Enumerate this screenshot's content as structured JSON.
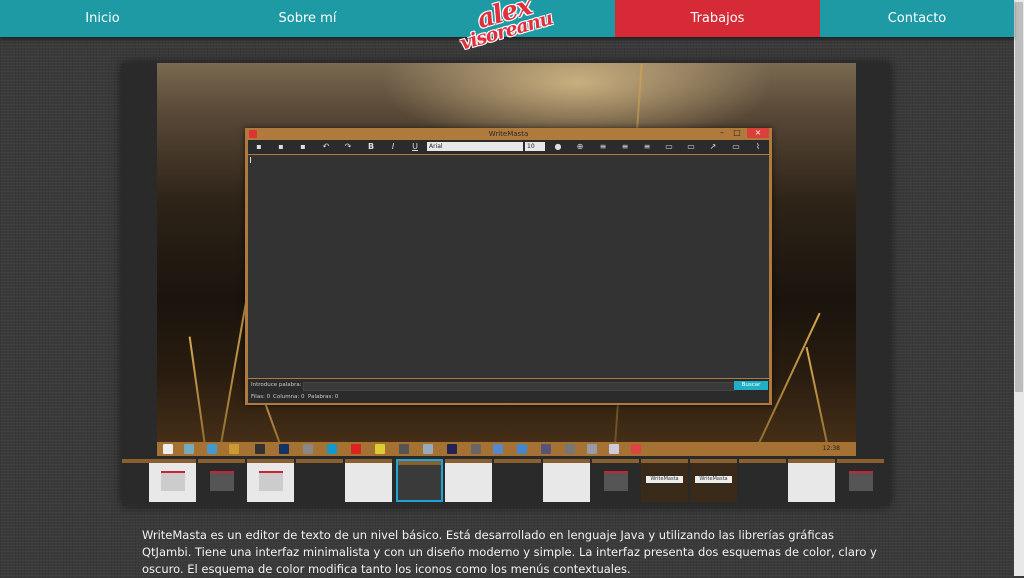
{
  "nav": {
    "items": [
      "Inicio",
      "Sobre mí",
      "Trabajos",
      "Contacto"
    ],
    "active": "Trabajos",
    "logo_line1": "alex",
    "logo_line2": "visoreanu"
  },
  "colors": {
    "nav": "#1e9aa4",
    "active": "#d62a36",
    "accent": "#1fb0c8"
  },
  "app": {
    "title": "WriteMasta",
    "font": "Arial",
    "font_size": "10",
    "search_label": "Introduce palabra:",
    "search_button": "Buscar",
    "status": [
      "Filas: 0",
      "Columna: 0",
      "Palabras: 0"
    ]
  },
  "taskbar": {
    "clock": "12:38"
  },
  "thumbnails": {
    "labels": [
      "WriteMasta",
      "WriteMasta",
      "WriteMasta"
    ],
    "selected_index": 6
  },
  "description": "WriteMasta es un editor de texto de un nivel básico. Está desarrollado en lenguaje Java y utilizando las librerías gráficas QtJambi. Tiene una interfaz minimalista y con un diseño moderno y simple. La interfaz presenta dos esquemas de color, claro y oscuro. El esquema de color modifica tanto los iconos como los menús contextuales."
}
